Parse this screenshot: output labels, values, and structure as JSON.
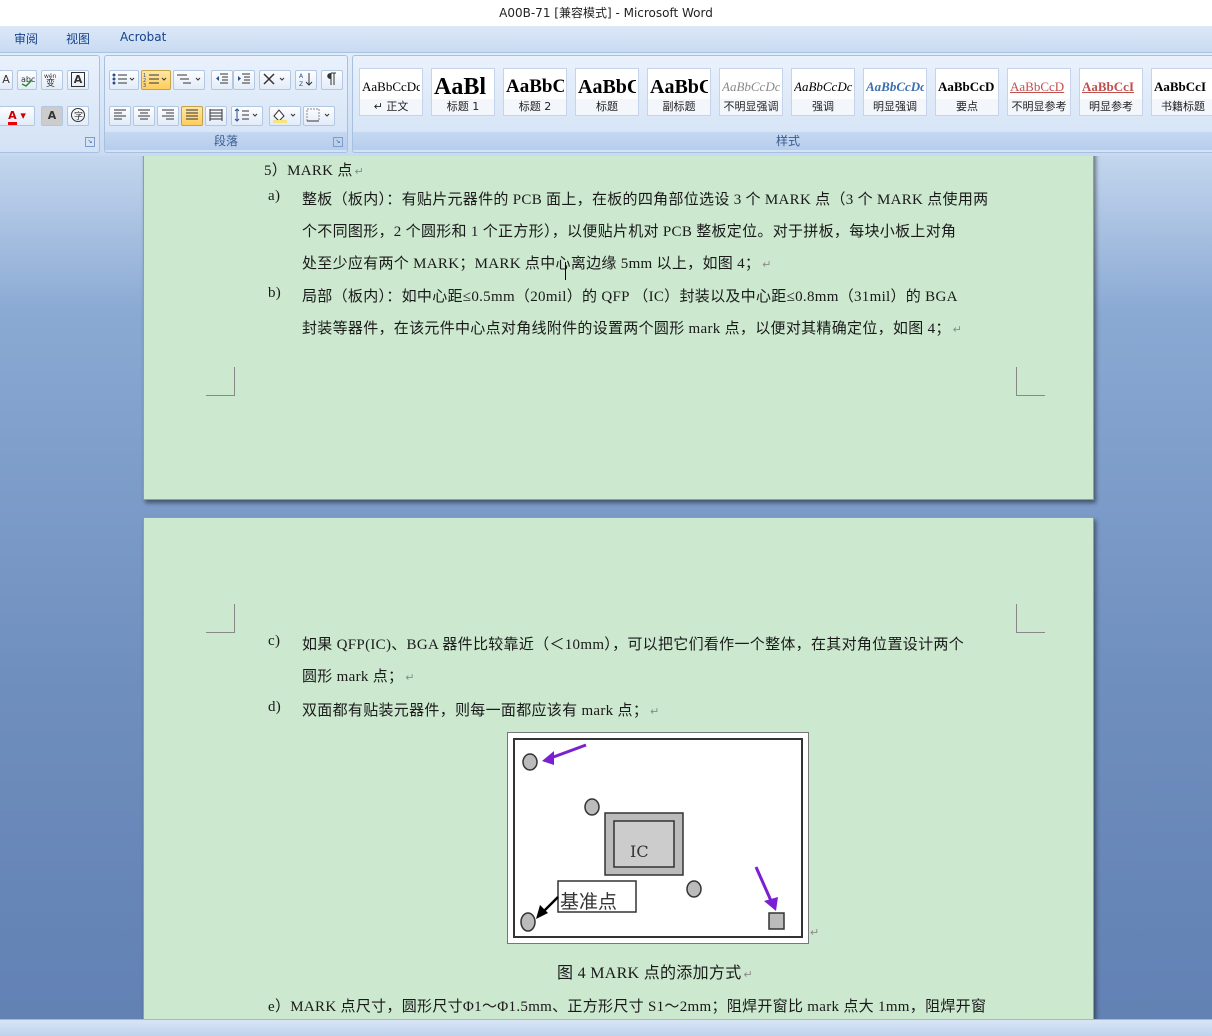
{
  "window": {
    "title": "A00B-71 [兼容模式] - Microsoft Word"
  },
  "ribbon_tabs": [
    "审阅",
    "视图",
    "Acrobat"
  ],
  "ribbon": {
    "paragraph_group_label": "段落",
    "styles_group_label": "样式",
    "styles": [
      {
        "sample": "AaBbCcDc",
        "name": "↵ 正文"
      },
      {
        "sample": "AaBl",
        "name": "标题 1"
      },
      {
        "sample": "AaBbC",
        "name": "标题 2"
      },
      {
        "sample": "AaBbC",
        "name": "标题"
      },
      {
        "sample": "AaBbC",
        "name": "副标题"
      },
      {
        "sample": "AaBbCcDc",
        "name": "不明显强调"
      },
      {
        "sample": "AaBbCcDc",
        "name": "强调"
      },
      {
        "sample": "AaBbCcDc",
        "name": "明显强调"
      },
      {
        "sample": "AaBbCcD",
        "name": "要点"
      },
      {
        "sample": "AaBbCcD",
        "name": "不明显参考"
      },
      {
        "sample": "AaBbCcI",
        "name": "明显参考"
      },
      {
        "sample": "AaBbCcI",
        "name": "书籍标题"
      }
    ],
    "font_buttons": [
      "A",
      "abc",
      "wén 变",
      "A"
    ],
    "font_buttons2": [
      "A",
      "A",
      "字"
    ]
  },
  "document": {
    "page1": {
      "heading": "5）MARK 点",
      "a_marker": "a)",
      "a_lines": [
        "整板（板内）：有贴片元器件的 PCB 面上，在板的四角部位选设 3 个 MARK 点（3 个 MARK 点使用两",
        "个不同图形，2 个圆形和 1 个正方形），以便贴片机对 PCB 整板定位。对于拼板，每块小板上对角",
        "处至少应有两个 MARK；MARK 点中心离边缘 5mm 以上，如图 4；"
      ],
      "b_marker": "b)",
      "b_lines": [
        "局部（板内）：如中心距≤0.5mm（20mil）的 QFP （IC）封装以及中心距≤0.8mm（31mil）的 BGA",
        "封装等器件，在该元件中心点对角线附件的设置两个圆形 mark 点，以便对其精确定位，如图 4；"
      ]
    },
    "page2": {
      "c_marker": "c)",
      "c_lines": [
        "如果 QFP(IC)、BGA 器件比较靠近（＜10mm），可以把它们看作一个整体，在其对角位置设计两个",
        "圆形 mark 点；"
      ],
      "d_marker": "d)",
      "d_line": "双面都有贴装元器件，则每一面都应该有 mark 点；",
      "figure": {
        "ic_label": "IC",
        "ref_label": "基准点"
      },
      "caption": "图 4  MARK 点的添加方式",
      "e_line": "e）MARK 点尺寸，圆形尺寸Φ1～Φ1.5mm、正方形尺寸 S1～2mm；阻焊开窗比 mark 点大 1mm，阻焊开窗"
    }
  },
  "colors": {
    "page_bg": "#cce8cf",
    "ribbon_bg": "#d6e4f6",
    "arrow": "#7a1fd1"
  }
}
